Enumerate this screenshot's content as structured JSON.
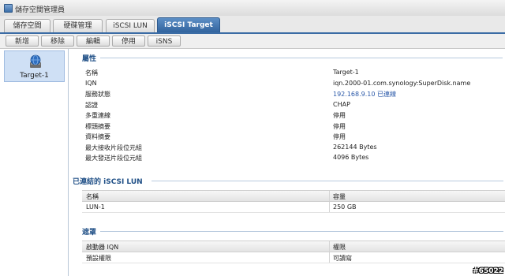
{
  "window": {
    "title": "儲存空間管理員"
  },
  "tabs": [
    {
      "label": "儲存空間"
    },
    {
      "label": "硬碟管理"
    },
    {
      "label": "iSCSI LUN"
    },
    {
      "label": "iSCSI Target"
    }
  ],
  "toolbar": {
    "buttons": [
      {
        "label": "新增"
      },
      {
        "label": "移除"
      },
      {
        "label": "編輯"
      },
      {
        "label": "停用"
      },
      {
        "label": "iSNS"
      }
    ]
  },
  "targets": [
    {
      "label": "Target-1",
      "icon": "globe-server-icon"
    }
  ],
  "properties": {
    "section_title": "屬性",
    "rows": [
      {
        "label": "名稱",
        "value": "Target-1"
      },
      {
        "label": "IQN",
        "value": "iqn.2000-01.com.synology:SuperDisk.name"
      },
      {
        "label": "服務狀態",
        "value": "192.168.9.10 已連線"
      },
      {
        "label": "認證",
        "value": "CHAP"
      },
      {
        "label": "多重連線",
        "value": "停用"
      },
      {
        "label": "標頭摘要",
        "value": "停用"
      },
      {
        "label": "資料摘要",
        "value": "停用"
      },
      {
        "label": "最大接收片段位元組",
        "value": "262144 Bytes"
      },
      {
        "label": "最大發送片段位元組",
        "value": "4096 Bytes"
      }
    ]
  },
  "linked_lun": {
    "section_title": "已連結的 iSCSI LUN",
    "columns": [
      "名稱",
      "容量"
    ],
    "rows": [
      [
        "LUN-1",
        "250 GB"
      ]
    ]
  },
  "masking": {
    "section_title": "遮罩",
    "columns": [
      "啟動器 IQN",
      "權限"
    ],
    "rows": [
      [
        "預設權限",
        "可讀寫"
      ]
    ]
  },
  "watermark": "#65022",
  "colors": {
    "accent": "#2f619b",
    "link": "#2a58a8",
    "selection": "#cfe0f5"
  }
}
